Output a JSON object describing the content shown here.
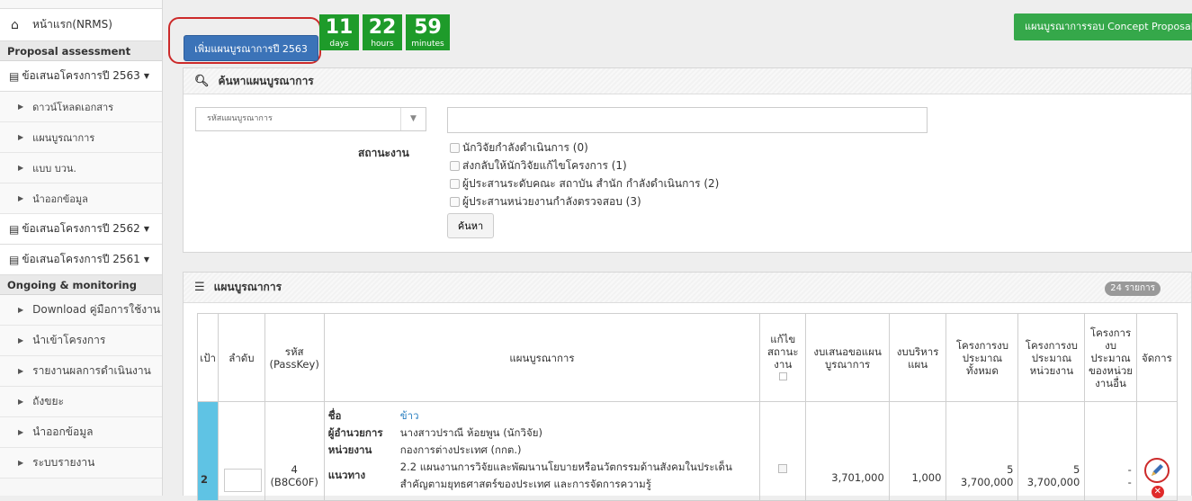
{
  "sidebar": {
    "home": "หน้าแรก(NRMS)",
    "section_proposal": "Proposal assessment",
    "group_2563": "ข้อเสนอโครงการปี 2563",
    "items_2563": [
      "ดาวน์โหลดเอกสาร",
      "แผนบูรณาการ",
      "แบบ บวน.",
      "นำออกข้อมูล"
    ],
    "group_2562": "ข้อเสนอโครงการปี 2562",
    "group_2561": "ข้อเสนอโครงการปี 2561",
    "section_ongoing": "Ongoing & monitoring",
    "items_ongoing": [
      "Download คู่มือการใช้งาน",
      "นำเข้าโครงการ",
      "รายงานผลการดำเนินงาน",
      "ถังขยะ",
      "นำออกข้อมูล",
      "ระบบรายงาน"
    ]
  },
  "toolbar": {
    "add_plan_label": "เพิ่มแผนบูรณาการปี 2563",
    "concept_label": "แผนบูรณาการรอบ Concept Proposal"
  },
  "countdown": {
    "days": "11",
    "days_label": "days",
    "hours": "22",
    "hours_label": "hours",
    "minutes": "59",
    "minutes_label": "minutes",
    "color": "#1e9b2a"
  },
  "search": {
    "title": "ค้นหาแผนบูรณาการ",
    "select_placeholder": "รหัสแผนบูรณาการ",
    "status_label": "สถานะงาน",
    "statuses": [
      "นักวิจัยกำลังดำเนินการ (0)",
      "ส่งกลับให้นักวิจัยแก้ไขโครงการ (1)",
      "ผู้ประสานระดับคณะ สถาบัน สำนัก กำลังดำเนินการ (2)",
      "ผู้ประสานหน่วยงานกำลังตรวจสอบ (3)"
    ],
    "button": "ค้นหา"
  },
  "plans": {
    "title": "แผนบูรณาการ",
    "count": "24 รายการ",
    "headers": {
      "goal": "เป้า",
      "order": "ลำดับ",
      "code": "รหัส (PassKey)",
      "plan": "แผนบูรณาการ",
      "edit_status": "แก้ไขสถานะงาน",
      "proposed_budget": "งบเสนอขอแผนบูรณาการ",
      "admin_budget": "งบบริหารแผน",
      "total_projects": "โครงการงบประมาณทั้งหมด",
      "unit_projects": "โครงการงบประมาณหน่วยงาน",
      "other_projects": "โครงการงบประมาณของหน่วยงานอื่น",
      "manage": "จัดการ"
    },
    "rows": [
      {
        "goal": "2",
        "code_num": "4",
        "code_key": "(B8C60F)",
        "name_label": "ชื่อ",
        "name": "ข้าว",
        "director_label": "ผู้อำนวยการ",
        "director": "นางสาวปราณี ห้อยพูน (นักวิจัย)",
        "agency_label": "หน่วยงาน",
        "agency": "กองการต่างประเทศ (กกต.)",
        "approach_label": "แนวทาง",
        "approach": "2.2 แผนงานการวิจัยและพัฒนานโยบายหรือนวัตกรรมด้านสังคมในประเด็นสำคัญตามยุทธศาสตร์ของประเทศ และการจัดการความรู้",
        "proposed_budget": "3,701,000",
        "admin_budget": "1,000",
        "total_count": "5",
        "total_budget": "3,700,000",
        "unit_count": "5",
        "unit_budget": "3,700,000",
        "other_a": "-",
        "other_b": "-"
      }
    ]
  }
}
